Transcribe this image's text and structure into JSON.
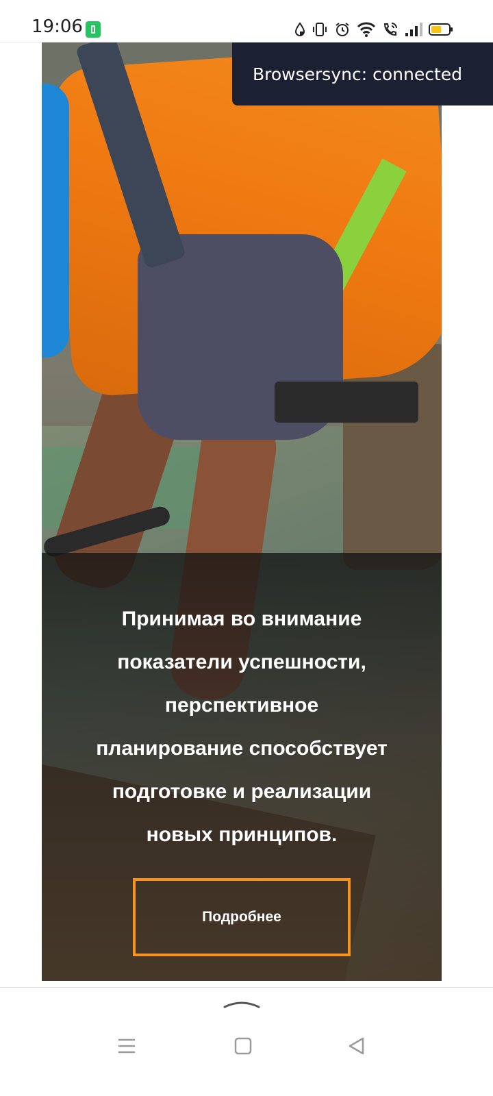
{
  "status_bar": {
    "time": "19:06",
    "icons": [
      "battery-saver-icon",
      "data-saver-icon",
      "vibrate-icon",
      "alarm-icon",
      "wifi-icon",
      "wifi-calling-icon",
      "signal-icon",
      "battery-icon"
    ],
    "battery_level": 0.6
  },
  "toast": {
    "text": "Browsersync: connected"
  },
  "card": {
    "image": "construction-worker-photo",
    "text_lines": [
      "Принимая во внимание",
      "показатели успешности,",
      "перспективное",
      "планирование способствует",
      "подготовке и реализации",
      "новых принципов."
    ],
    "button_label": "Подробнее"
  },
  "nav_bar": {
    "buttons": [
      "menu-icon",
      "home-icon",
      "back-icon"
    ]
  },
  "colors": {
    "accent": "#f7931e",
    "toast_bg": "#1b2033",
    "battery_saver": "#22c55e",
    "battery_fill": "#f5c518"
  }
}
